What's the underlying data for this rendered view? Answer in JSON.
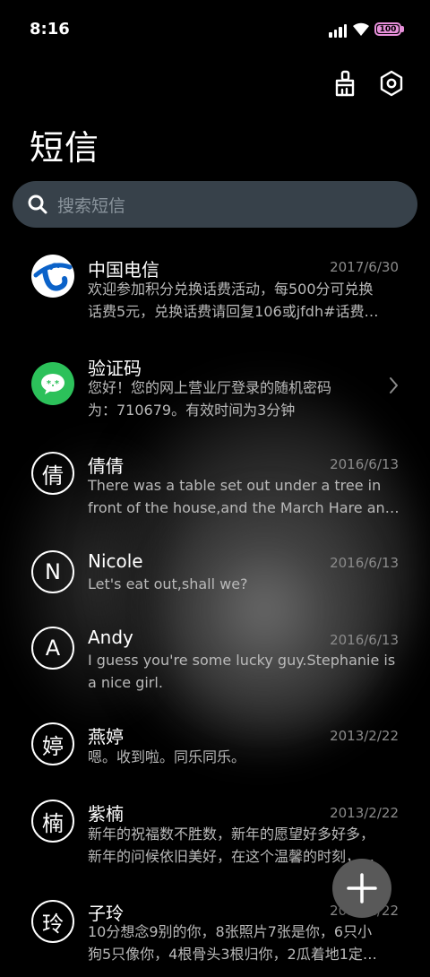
{
  "status": {
    "time": "8:16",
    "battery": "100"
  },
  "header": {
    "title": "短信"
  },
  "search": {
    "placeholder": "搜索短信"
  },
  "conversations": [
    {
      "name": "中国电信",
      "date": "2017/6/30",
      "avatar": "telecom-logo",
      "line1": "欢迎参加积分兑换话费活动，每500分可兑换",
      "line2": "话费5元，兑换话费请回复106或jfdh#话费…"
    },
    {
      "name": "验证码",
      "date": "",
      "avatar": "wechat-logo",
      "line1": "您好！您的网上营业厅登录的随机密码",
      "line2": "为：710679。有效时间为3分钟"
    },
    {
      "name": "倩倩",
      "date": "2016/6/13",
      "avatar": "倩",
      "line1": "There was a table set out under a tree in",
      "line2": "front of the house,and the March Hare an…"
    },
    {
      "name": "Nicole",
      "date": "2016/6/13",
      "avatar": "N",
      "line1": "Let's eat out,shall we?",
      "line2": ""
    },
    {
      "name": "Andy",
      "date": "2016/6/13",
      "avatar": "A",
      "line1": "I guess you're some lucky guy.Stephanie is",
      "line2": "a nice girl."
    },
    {
      "name": "燕婷",
      "date": "2013/2/22",
      "avatar": "婷",
      "line1": "嗯。收到啦。同乐同乐。",
      "line2": ""
    },
    {
      "name": "紫楠",
      "date": "2013/2/22",
      "avatar": "楠",
      "line1": "新年的祝福数不胜数，新年的愿望好多好多，",
      "line2": "新年的问候依旧美好，在这个温馨的时刻，…"
    },
    {
      "name": "子玲",
      "date": "2013/2/22",
      "avatar": "玲",
      "line1": "10分想念9别的你，8张照片7张是你，6只小",
      "line2": "狗5只像你，4根骨头3根归你，2瓜着地1定…"
    }
  ],
  "icons": {
    "clean": "broom-icon",
    "settings": "gear-icon",
    "search": "search-icon",
    "compose": "plus-icon",
    "chevron": "chevron-right-icon"
  },
  "colors": {
    "search_bg": "#37414a",
    "battery": "#e68fd9",
    "wechat_green": "#2cc15a",
    "telecom_blue": "#0b62c9"
  }
}
